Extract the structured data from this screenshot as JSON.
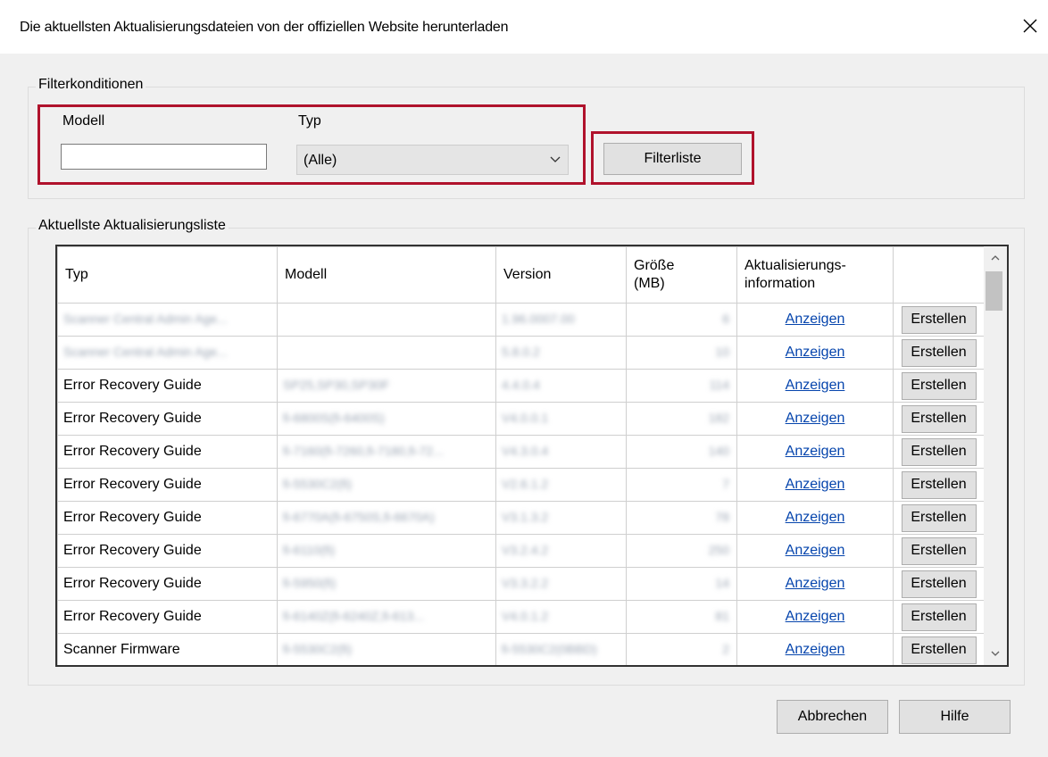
{
  "window": {
    "title": "Die aktuellsten Aktualisierungsdateien von der offiziellen Website herunterladen"
  },
  "filter": {
    "group_label": "Filterkonditionen",
    "model_label": "Modell",
    "model_value": "",
    "type_label": "Typ",
    "type_value": "(Alle)",
    "filter_button": "Filterliste"
  },
  "list": {
    "group_label": "Aktuellste Aktualisierungsliste",
    "columns": [
      "Typ",
      "Modell",
      "Version",
      "Größe\n(MB)",
      "Aktualisierungs-\ninformation",
      ""
    ],
    "rows": [
      {
        "typ": "Scanner Central Admin Age...",
        "modell": "",
        "version": "1.96.0007.00",
        "size": "6",
        "link": "Anzeigen",
        "action": "Erstellen"
      },
      {
        "typ": "Scanner Central Admin Age...",
        "modell": "",
        "version": "5.8.0.2",
        "size": "10",
        "link": "Anzeigen",
        "action": "Erstellen"
      },
      {
        "typ": "Error Recovery Guide",
        "modell": "SP25,SP30,SP30F",
        "version": "4.4.0.4",
        "size": "114",
        "link": "Anzeigen",
        "action": "Erstellen"
      },
      {
        "typ": "Error Recovery Guide",
        "modell": "fi-6800S(fi-6400S)",
        "version": "V4.0.0.1",
        "size": "182",
        "link": "Anzeigen",
        "action": "Erstellen"
      },
      {
        "typ": "Error Recovery Guide",
        "modell": "fi-7160(fi-7260,fi-7180,fi-72...",
        "version": "V4.3.0.4",
        "size": "140",
        "link": "Anzeigen",
        "action": "Erstellen"
      },
      {
        "typ": "Error Recovery Guide",
        "modell": "fi-5530C2(fi)",
        "version": "V2.6.1.2",
        "size": "7",
        "link": "Anzeigen",
        "action": "Erstellen"
      },
      {
        "typ": "Error Recovery Guide",
        "modell": "fi-6770A(fi-6750S,fi-6670A)",
        "version": "V3.1.3.2",
        "size": "78",
        "link": "Anzeigen",
        "action": "Erstellen"
      },
      {
        "typ": "Error Recovery Guide",
        "modell": "fi-6110(fi)",
        "version": "V3.2.4.2",
        "size": "250",
        "link": "Anzeigen",
        "action": "Erstellen"
      },
      {
        "typ": "Error Recovery Guide",
        "modell": "fi-5950(fi)",
        "version": "V3.3.2.2",
        "size": "14",
        "link": "Anzeigen",
        "action": "Erstellen"
      },
      {
        "typ": "Error Recovery Guide",
        "modell": "fi-6140Z(fi-6240Z,fi-613...",
        "version": "V4.0.1.2",
        "size": "81",
        "link": "Anzeigen",
        "action": "Erstellen"
      },
      {
        "typ": "Scanner Firmware",
        "modell": "fi-5530C2(fi)",
        "version": "fi-5530C2(0BBD)",
        "size": "2",
        "link": "Anzeigen",
        "action": "Erstellen"
      }
    ]
  },
  "footer": {
    "cancel": "Abbrechen",
    "help": "Hilfe"
  },
  "icons": {
    "close": "close-icon",
    "dropdown": "chevron-down-icon",
    "scroll_up": "scroll-up-icon",
    "scroll_down": "scroll-down-icon"
  },
  "colors": {
    "highlight": "#b0122c",
    "link": "#0645ad"
  }
}
